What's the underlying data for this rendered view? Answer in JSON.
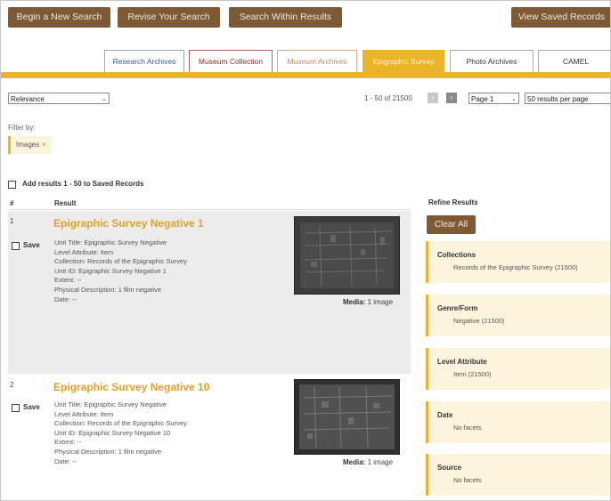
{
  "top_buttons": {
    "begin": "Begin a New Search",
    "revise": "Revise Your Search",
    "within": "Search Within Results",
    "saved": "View Saved Records"
  },
  "tabs": [
    "Research Archives",
    "Museum Collection",
    "Museum Archives",
    "Epigraphic Survey",
    "Photo Archives",
    "CAMEL"
  ],
  "active_tab": "Epigraphic Survey",
  "sort": {
    "selected": "Relevance"
  },
  "results_count": "1 - 50 of 21500",
  "pager": {
    "prev": "‹",
    "next": "›",
    "page_select": "Page 1",
    "per_page_select": "50 results per page"
  },
  "filter": {
    "label": "Filter by:",
    "chip": "Images",
    "chip_remove": "×"
  },
  "add_results_label": "Add results 1 - 50 to Saved Records",
  "columns": {
    "num": "#",
    "result": "Result"
  },
  "results": [
    {
      "num": "1",
      "title": "Epigraphic Survey Negative 1",
      "save": "Save",
      "unit_title": "Unit Title: Epigraphic Survey Negative",
      "level": "Level Attribute: Item",
      "collection": "Collection: Records of the Epigraphic Survey",
      "unit_id": "Unit ID: Epigraphic Survey Negative 1",
      "extent": "Extent: --",
      "physical": "Physical Description: 1 film negative",
      "date": "Date: --",
      "media_label": "Media:",
      "media_value": "1 image"
    },
    {
      "num": "2",
      "title": "Epigraphic Survey Negative 10",
      "save": "Save",
      "unit_title": "Unit Title: Epigraphic Survey Negative",
      "level": "Level Attribute: Item",
      "collection": "Collection: Records of the Epigraphic Survey",
      "unit_id": "Unit ID: Epigraphic Survey Negative 10",
      "extent": "Extent: --",
      "physical": "Physical Description: 1 film negative",
      "date": "Date: --",
      "media_label": "Media:",
      "media_value": "1 image"
    }
  ],
  "refine": {
    "title": "Refine Results",
    "clear_all": "Clear All",
    "facets": [
      {
        "title": "Collections",
        "value": "Records of the Epigraphic Survey (21500)"
      },
      {
        "title": "Genre/Form",
        "value": "Negative (21500)"
      },
      {
        "title": "Level Attribute",
        "value": "Item (21500)"
      },
      {
        "title": "Date",
        "value": "No facets"
      },
      {
        "title": "Source",
        "value": "No facets"
      }
    ]
  },
  "colors": {
    "brown_button": "#7d5a35",
    "gold": "#eab32a",
    "facet_bg": "#fcf4dc"
  }
}
